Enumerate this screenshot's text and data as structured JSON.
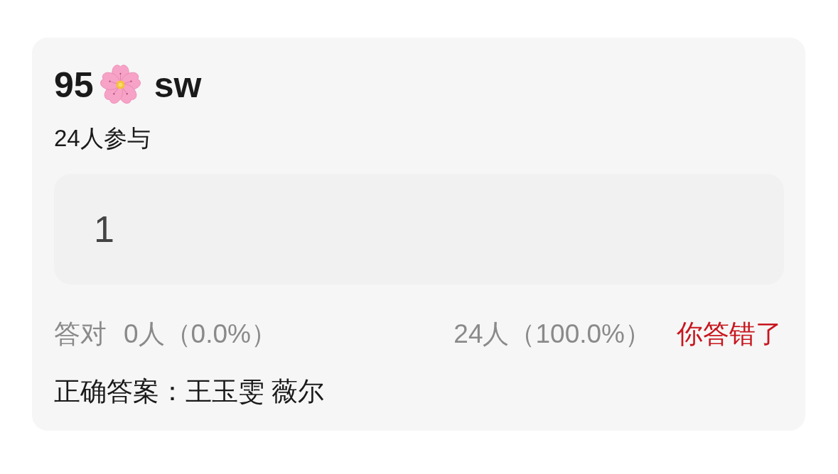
{
  "card": {
    "title_start": "95",
    "title_end": "sw",
    "participants": "24人参与",
    "answer": "1",
    "stats": {
      "correct_label": "答对",
      "correct_count": "0人（0.0%）",
      "wrong_count": "24人（100.0%）"
    },
    "result": {
      "text": "你答错了",
      "correct": false
    },
    "correct_answer": "正确答案：王玉雯 薇尔"
  }
}
